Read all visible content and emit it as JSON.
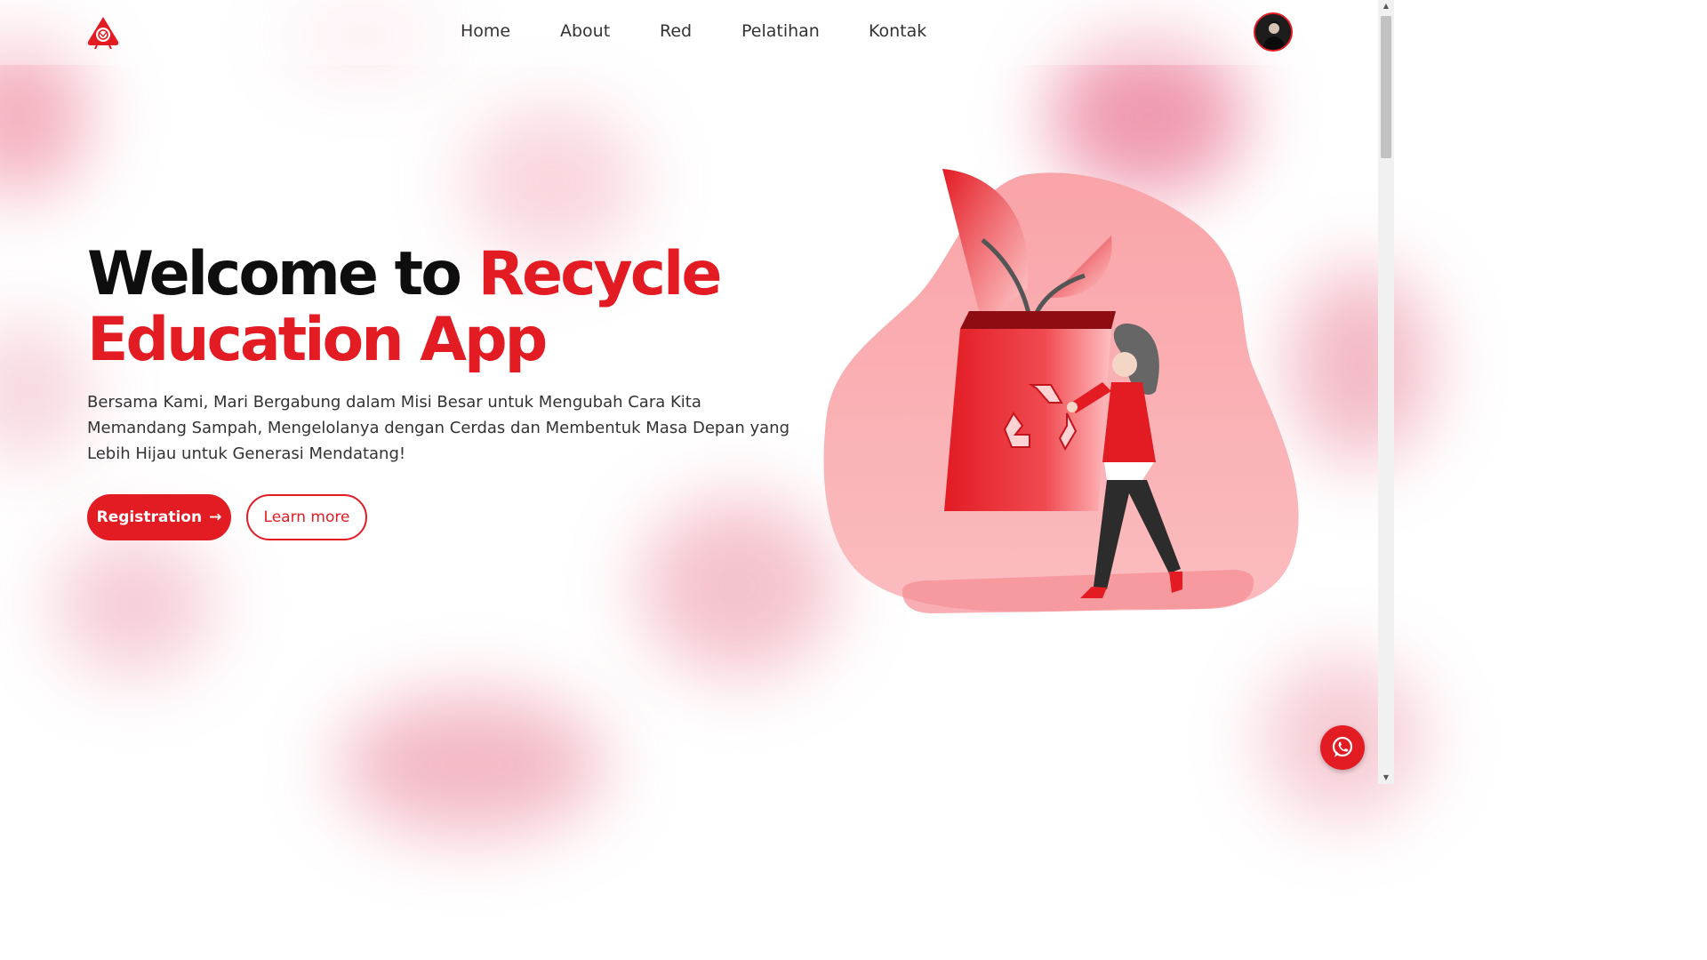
{
  "nav": {
    "items": [
      {
        "label": "Home"
      },
      {
        "label": "About"
      },
      {
        "label": "Red"
      },
      {
        "label": "Pelatihan"
      },
      {
        "label": "Kontak"
      }
    ]
  },
  "hero": {
    "title_part1": "Welcome to ",
    "title_accent1": "Recycle",
    "title_accent2": "Education App",
    "description": "Bersama Kami, Mari Bergabung dalam Misi Besar untuk Mengubah Cara Kita Memandang Sampah, Mengelolanya dengan Cerdas dan Membentuk Masa Depan yang Lebih Hijau untuk Generasi Mendatang!",
    "primary_button": "Registration",
    "primary_button_icon": "→",
    "secondary_button": "Learn more"
  },
  "icons": {
    "logo": "recycle-logo-icon",
    "avatar": "user-avatar",
    "whatsapp": "whatsapp-icon",
    "illustration": "recycle-bag-illustration"
  },
  "colors": {
    "accent": "#e31b23",
    "text": "#0e0e0e",
    "blob": "#e8607e"
  }
}
